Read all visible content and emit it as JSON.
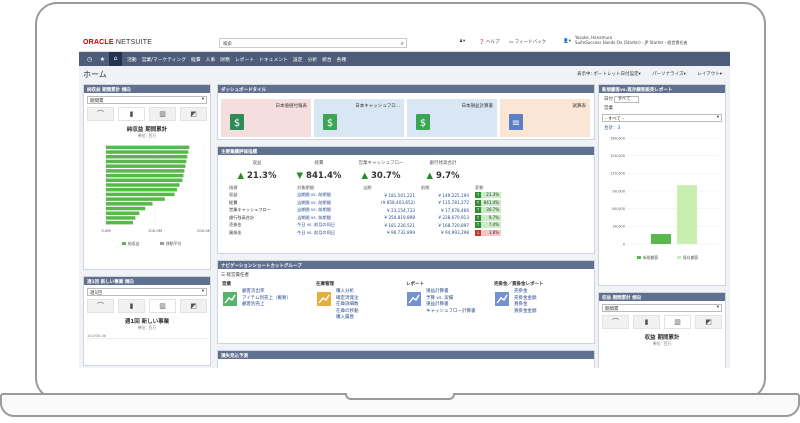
{
  "app": {
    "logo_oracle": "ORACLE",
    "logo_netsuite": "NETSUITE",
    "search_placeholder": "検索",
    "help": "ヘルプ",
    "feedback": "フィードバック",
    "user_name": "Yosuke, Hanamura",
    "user_company": "SuiteSuccess Hands-On (Starter) - JP Starter - 経営責任者"
  },
  "nav": {
    "items": [
      "活動",
      "営業/マーケティング",
      "経費",
      "人事",
      "財務",
      "レポート",
      "ドキュメント",
      "設定",
      "分析",
      "統合",
      "各種"
    ]
  },
  "page": {
    "title": "ホーム",
    "tools": [
      "表示中: ポートレット日付設定",
      "パーソナライズ",
      "レイアウト"
    ]
  },
  "left1": {
    "title": "純収益 期間累計 傾向",
    "filter": "期間累",
    "chart_title": "純収益 期間累計",
    "chart_sub": "単位: 百万",
    "legend": [
      "純収益",
      "移動平均"
    ],
    "chart_data": {
      "type": "bar",
      "orientation": "horizontal",
      "categories": [
        "1",
        "2",
        "3",
        "4",
        "5",
        "6",
        "7",
        "8",
        "9",
        "10",
        "11",
        "12",
        "13",
        "14",
        "15",
        "16",
        "17"
      ],
      "values": [
        170,
        168,
        166,
        164,
        162,
        160,
        158,
        156,
        150,
        145,
        140,
        120,
        95,
        80,
        68,
        60,
        55
      ],
      "xlim": [
        0,
        200
      ],
      "ticks": [
        "0.0M",
        "100.0M",
        "200.0M"
      ]
    }
  },
  "left2": {
    "title": "週1回 新しい事業 傾向",
    "filter": "週1回",
    "chart_title": "週1回 新しい事業",
    "chart_sub": "単位: 百万",
    "axis_label": "10,000.0k"
  },
  "dash": {
    "title": "ダッシュボードタイル",
    "tiles": [
      {
        "label": "日本値値付報表",
        "color": "#f6dede",
        "icon_color": "#2e8b57"
      },
      {
        "label": "日本キャッシュフロ...",
        "color": "#d9e7f5",
        "icon_color": "#3aa655"
      },
      {
        "label": "日本損益計算書",
        "color": "#d9e7f5",
        "icon_color": "#3aa655"
      },
      {
        "label": "試算表",
        "color": "#fbe5d4",
        "icon_color": "#5a80c8"
      }
    ]
  },
  "kpi": {
    "title": "主要業績評価指標",
    "cards": [
      {
        "label": "収益",
        "value": "21.3%",
        "dir": "up"
      },
      {
        "label": "経費",
        "value": "841.4%",
        "dir": "down"
      },
      {
        "label": "営業キャッシュフロー",
        "value": "30.7%",
        "dir": "up"
      },
      {
        "label": "銀行残高合計",
        "value": "9.7%",
        "dir": "up"
      }
    ],
    "headers": [
      "指標",
      "対象期間",
      "当期",
      "前期",
      "変動"
    ],
    "rows": [
      {
        "name": "収益",
        "period": "当期間 vs. 前期間",
        "cur": "¥ 181,501,221",
        "prev": "¥ 149,225,194",
        "chg": "21.3%",
        "pos": true
      },
      {
        "name": "経費",
        "period": "当期間 vs. 前期間",
        "cur": "(¥ 858,403,652)",
        "prev": "¥ 115,781,272",
        "chg": "841.4%",
        "pos": true
      },
      {
        "name": "営業キャッシュフロー",
        "period": "当期間 vs. 前期間",
        "cur": "¥ 23,154,733",
        "prev": "¥ 17,678,466",
        "chg": "30.7%",
        "pos": true
      },
      {
        "name": "銀行残高合計",
        "period": "当期間 vs. 前期間",
        "cur": "¥ 250,819,898",
        "prev": "¥ 228,670,913",
        "chg": "9.7%",
        "pos": true
      },
      {
        "name": "売掛金",
        "period": "今日 vs. 前月の同日",
        "cur": "¥ 181,226,521",
        "prev": "¥ 168,720,897",
        "chg": "7.4%",
        "pos": true
      },
      {
        "name": "買掛金",
        "period": "今日 vs. 前月の同日",
        "cur": "¥ 96,732,899",
        "prev": "¥ 94,993,298",
        "chg": "1.8%",
        "pos": false
      }
    ]
  },
  "shortcuts": {
    "title": "ナビゲーションショートカットグループ",
    "subtitle": "経営責任者",
    "groups": [
      {
        "title": "営業",
        "links": [
          "顧客流出率",
          "アイテム別売上（概要）",
          "顧客別売上"
        ]
      },
      {
        "title": "在庫管理",
        "links": [
          "購入分析",
          "確定済発注",
          "在庫詳細数",
          "在庫の移動",
          "購入履歴"
        ]
      },
      {
        "title": "レポート",
        "links": [
          "損益計算書",
          "予算 vs. 実績",
          "損益計算書",
          "キャッシュフロー計算書"
        ]
      },
      {
        "title": "売掛金／買掛金レポート",
        "links": [
          "売掛金",
          "売掛金金額",
          "買掛金",
          "買掛金金額"
        ]
      }
    ]
  },
  "center3": {
    "title": "損失見込予測"
  },
  "right1": {
    "title": "新規顧客vs.既存顧客販売レポート",
    "date_label": "日付",
    "date_value": "すべて",
    "sales_rep_label": "営業",
    "sales_rep_value": "- すべて -",
    "count": "合計：3",
    "legend": [
      "新規顧客",
      "既存顧客"
    ],
    "chart_data": {
      "type": "bar",
      "categories": [
        "新規顧客",
        "既存顧客"
      ],
      "values": [
        17000,
        100000
      ],
      "ylim": [
        0,
        180000
      ],
      "ticks": [
        "180,000",
        "150,000",
        "120,000",
        "90,000",
        "60,000",
        "30,000",
        "0"
      ]
    }
  },
  "right2": {
    "title": "収益 期間累計 傾向",
    "filter": "期間累",
    "chart_title": "収益 期間累計",
    "chart_sub": "単位: 百万"
  }
}
